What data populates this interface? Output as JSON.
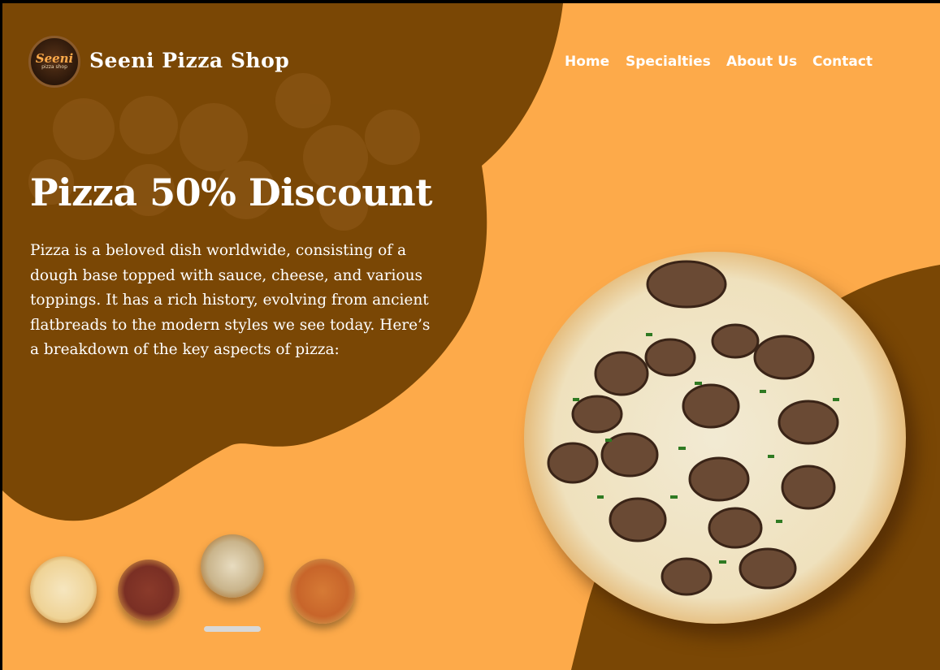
{
  "brand": {
    "name": "Seeni Pizza Shop",
    "logo_line1": "Seeni",
    "logo_line2": "pizza shop"
  },
  "nav": {
    "items": [
      "Home",
      "Specialties",
      "About Us",
      "Contact"
    ]
  },
  "hero": {
    "headline": "Pizza 50% Discount",
    "description": "Pizza is a beloved dish worldwide, consisting of a dough base topped with sauce, cheese, and various toppings. It has a rich history, evolving from ancient flatbreads to the modern styles we see today. Here’s a breakdown of the key aspects of pizza:"
  },
  "carousel": {
    "thumbnails": [
      "cheese-pizza",
      "pepperoni-olive-pizza",
      "mushroom-pizza",
      "veggie-pizza"
    ],
    "active_index": 2
  },
  "colors": {
    "background": "#FDAA4A",
    "accent_brown": "#7A4705",
    "text": "#FFFFFF"
  }
}
